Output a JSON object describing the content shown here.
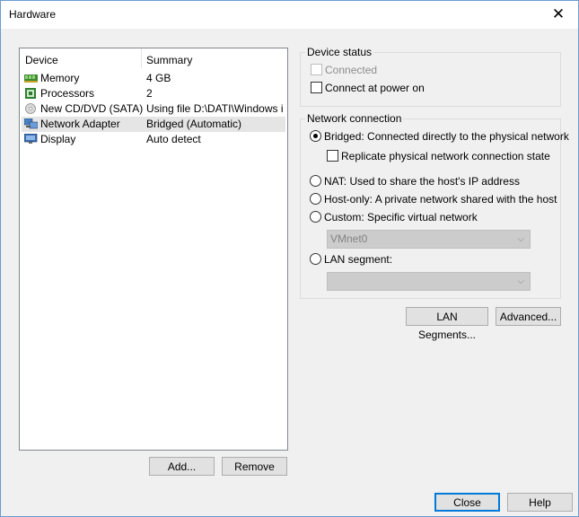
{
  "window": {
    "title": "Hardware"
  },
  "device_list": {
    "columns": [
      "Device",
      "Summary"
    ],
    "rows": [
      {
        "device": "Memory",
        "summary": "4 GB",
        "icon": "memory-icon"
      },
      {
        "device": "Processors",
        "summary": "2",
        "icon": "processor-icon"
      },
      {
        "device": "New CD/DVD (SATA)",
        "summary": "Using file D:\\DATI\\Windows i...",
        "icon": "cd-dvd-icon"
      },
      {
        "device": "Network Adapter",
        "summary": "Bridged (Automatic)",
        "icon": "network-adapter-icon",
        "selected": true
      },
      {
        "device": "Display",
        "summary": "Auto detect",
        "icon": "display-icon"
      }
    ],
    "add_label": "Add...",
    "remove_label": "Remove"
  },
  "device_status": {
    "title": "Device status",
    "connected_label": "Connected",
    "connect_at_power_on_label": "Connect at power on"
  },
  "network_connection": {
    "title": "Network connection",
    "bridged_label": "Bridged: Connected directly to the physical network",
    "replicate_label": "Replicate physical network connection state",
    "nat_label": "NAT: Used to share the host's IP address",
    "host_only_label": "Host-only: A private network shared with the host",
    "custom_label": "Custom: Specific virtual network",
    "vmnet_value": "VMnet0",
    "lan_segment_label": "LAN segment:",
    "lan_segment_value": "",
    "selected": "bridged"
  },
  "buttons": {
    "lan_segments": "LAN Segments...",
    "advanced": "Advanced...",
    "close": "Close",
    "help": "Help"
  }
}
